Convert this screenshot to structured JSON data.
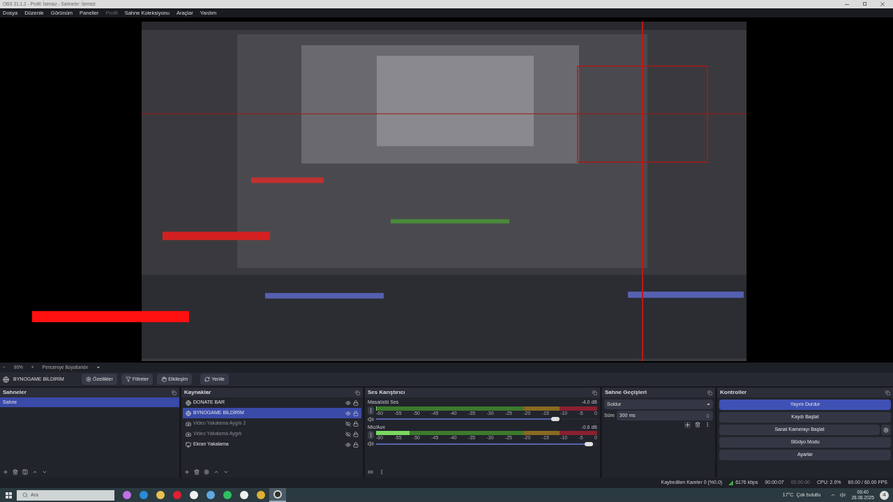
{
  "window": {
    "title": "OBS 31.1.2 - Profil: İsimsiz - Sahneler: İsimsiz"
  },
  "menu": [
    {
      "label": "Dosya",
      "disabled": false
    },
    {
      "label": "Düzenle",
      "disabled": false
    },
    {
      "label": "Görünüm",
      "disabled": false
    },
    {
      "label": "Paneller",
      "disabled": false
    },
    {
      "label": "Profil",
      "disabled": true
    },
    {
      "label": "Sahne Koleksiyonu",
      "disabled": false
    },
    {
      "label": "Araçlar",
      "disabled": false
    },
    {
      "label": "Yardım",
      "disabled": false
    }
  ],
  "zoom_bar": {
    "minus": "−",
    "zoom": "90%",
    "plus": "+",
    "fit": "Pencereye Boyutlandır"
  },
  "source_toolbar": {
    "source": "BYNOGAME BİLDİRİM",
    "buttons": [
      {
        "kind": "properties",
        "label": "Özellikler"
      },
      {
        "kind": "filters",
        "label": "Filtreler"
      },
      {
        "kind": "interact",
        "label": "Etkileşim"
      },
      {
        "kind": "refresh",
        "label": "Yenile"
      }
    ]
  },
  "scenes": {
    "title": "Sahneler",
    "items": [
      {
        "name": "Sahne",
        "selected": true
      }
    ]
  },
  "sources": {
    "title": "Kaynaklar",
    "items": [
      {
        "name": "DONATE BAR",
        "kind": "browser",
        "visible": true,
        "selected": false
      },
      {
        "name": "BYNOGAME BİLDİRİM",
        "kind": "browser",
        "visible": true,
        "selected": true
      },
      {
        "name": "Video Yakalama Aygıtı 2",
        "kind": "camera",
        "visible": false,
        "selected": false
      },
      {
        "name": "Video Yakalama Aygıtı",
        "kind": "camera",
        "visible": false,
        "selected": false
      },
      {
        "name": "Ekran Yakalama",
        "kind": "display",
        "visible": true,
        "selected": false
      }
    ]
  },
  "mixer": {
    "title": "Ses Karıştırıcı",
    "channels": [
      {
        "name": "Masaüstü Ses",
        "reading": "-4.0 dB",
        "meter": {
          "level": 0
        },
        "volume": {
          "level": 0.83
        },
        "ticks": [
          "-60",
          "-55",
          "-50",
          "-45",
          "-40",
          "-35",
          "-30",
          "-25",
          "-20",
          "-15",
          "-10",
          "-5",
          "0"
        ]
      },
      {
        "name": "Mic/Aux",
        "reading": "-0.6 dB",
        "meter": {
          "level": 0.15
        },
        "volume": {
          "level": 0.98
        },
        "ticks": [
          "-60",
          "-55",
          "-50",
          "-45",
          "-40",
          "-35",
          "-30",
          "-25",
          "-20",
          "-15",
          "-10",
          "-5",
          "0"
        ]
      }
    ]
  },
  "transitions": {
    "title": "Sahne Geçişleri",
    "transition": "Soldur",
    "duration_label": "Süre",
    "duration": "300 ms"
  },
  "controls": {
    "title": "Kontroller",
    "buttons": [
      {
        "label": "Yayını Durdur",
        "active": true,
        "settings": false
      },
      {
        "label": "Kaydı Başlat",
        "active": false,
        "settings": false
      },
      {
        "label": "Sanal Kamerayı Başlat",
        "active": false,
        "settings": true
      },
      {
        "label": "Stüdyo Modu",
        "active": false,
        "settings": false
      },
      {
        "label": "Ayarlar",
        "active": false,
        "settings": false
      }
    ]
  },
  "status_bar": {
    "dropped": "Kaybedilen Kareler 0 (%0.0)",
    "bitrate": "6176 kbps",
    "stream_time": "00:00:07",
    "record_time": "00:00:00",
    "cpu": "CPU: 2.0%",
    "fps": "60.00 / 60.00 FPS"
  },
  "taskbar": {
    "search_placeholder": "Ara",
    "apps": [
      {
        "kind": "copilot",
        "selected": false
      },
      {
        "kind": "edge",
        "selected": false
      },
      {
        "kind": "folder",
        "selected": false
      },
      {
        "kind": "opera",
        "selected": false
      },
      {
        "kind": "capcut",
        "selected": false
      },
      {
        "kind": "cloud",
        "selected": false
      },
      {
        "kind": "whatsapp",
        "selected": false
      },
      {
        "kind": "capcut",
        "selected": false
      },
      {
        "kind": "chrome",
        "selected": false
      },
      {
        "kind": "obs",
        "selected": true
      }
    ],
    "temperature": "17°C",
    "weather": "Çok bulutlu",
    "time": "06:40",
    "date": "28.08.2025",
    "notifications": "4"
  }
}
